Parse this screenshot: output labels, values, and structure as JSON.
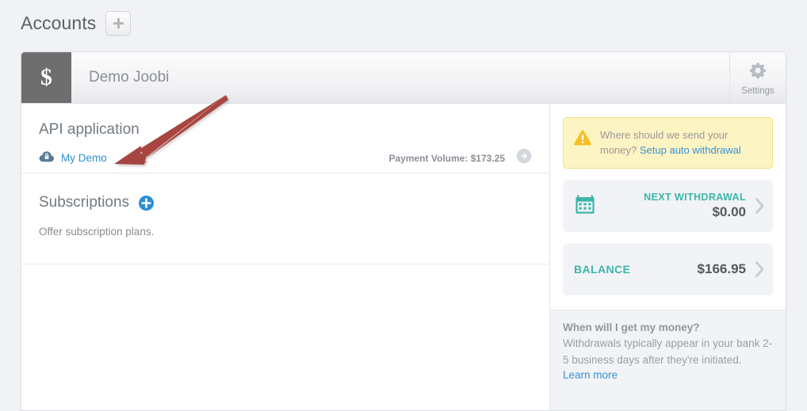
{
  "header": {
    "title": "Accounts",
    "add_button_icon": "plus-icon"
  },
  "account": {
    "badge_symbol": "$",
    "name": "Demo Joobi",
    "settings_label": "Settings",
    "settings_icon": "gear-icon"
  },
  "api_section": {
    "title": "API application",
    "app_icon": "cloud-lock-icon",
    "app_name": "My Demo",
    "payment_volume": "Payment Volume: $173.25",
    "details_icon": "arrow-right-circle-icon"
  },
  "subscriptions_section": {
    "title": "Subscriptions",
    "add_icon": "plus-circle-icon",
    "description": "Offer subscription plans."
  },
  "sidebar": {
    "alert": {
      "icon": "warning-triangle-icon",
      "text": "Where should we send your money? ",
      "link_text": "Setup auto withdrawal"
    },
    "cards": [
      {
        "icon": "calendar-icon",
        "label": "NEXT WITHDRAWAL",
        "value": "$0.00",
        "chevron": "chevron-right-icon"
      },
      {
        "icon": "",
        "label": "BALANCE",
        "value": "$166.95",
        "chevron": "chevron-right-icon"
      }
    ],
    "faq": {
      "title": "When will I get my money?",
      "body": "Withdrawals typically appear in your bank 2-5 business days after they're initiated.",
      "link_text": "Learn more"
    }
  },
  "annotation": {
    "type": "arrow",
    "color": "#a8443f",
    "points_to": "My Demo link"
  },
  "colors": {
    "accent_blue": "#2b93d6",
    "accent_teal": "#3db5a8",
    "alert_bg": "#fdf4c4",
    "page_bg": "#f0f2f5",
    "badge_bg": "#6e6e6e"
  }
}
